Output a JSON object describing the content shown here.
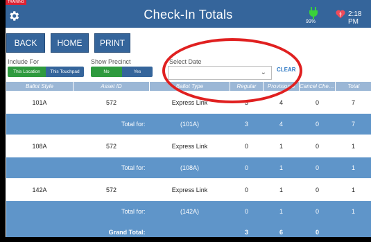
{
  "header": {
    "badge": "TRAINING",
    "title": "Check-In Totals",
    "battery": "99%",
    "time": "2:18 PM"
  },
  "toolbar": {
    "back": "BACK",
    "home": "HOME",
    "print": "PRINT"
  },
  "filters": {
    "include_label": "Include For",
    "include_options": [
      "This Location",
      "This Touchpad"
    ],
    "precinct_label": "Show Precinct",
    "precinct_options": [
      "No",
      "Yes"
    ],
    "date_label": "Select Date",
    "date_value": "",
    "clear": "CLEAR"
  },
  "table": {
    "columns": [
      "Ballot Style",
      "Asset ID",
      "Ballot Type",
      "Regular",
      "Provisional",
      "Cancel Check-In",
      "Total"
    ],
    "rows": [
      {
        "style": "101A",
        "asset": "572",
        "type": "Express Link",
        "regular": "3",
        "provisional": "4",
        "cancel": "0",
        "total": "7"
      },
      {
        "label": "Total for:",
        "style": "(101A)",
        "regular": "3",
        "provisional": "4",
        "cancel": "0",
        "total": "7"
      },
      {
        "style": "108A",
        "asset": "572",
        "type": "Express Link",
        "regular": "0",
        "provisional": "1",
        "cancel": "0",
        "total": "1"
      },
      {
        "label": "Total for:",
        "style": "(108A)",
        "regular": "0",
        "provisional": "1",
        "cancel": "0",
        "total": "1"
      },
      {
        "style": "142A",
        "asset": "572",
        "type": "Express Link",
        "regular": "0",
        "provisional": "1",
        "cancel": "0",
        "total": "1"
      },
      {
        "label": "Total for:",
        "style": "(142A)",
        "regular": "0",
        "provisional": "1",
        "cancel": "0",
        "total": "1"
      }
    ],
    "grand": {
      "label": "Grand Total:",
      "regular": "3",
      "provisional": "6",
      "cancel": "0"
    }
  },
  "colors": {
    "header": "#35659b",
    "total_row": "#5f95c9",
    "annotation": "#e02020"
  }
}
